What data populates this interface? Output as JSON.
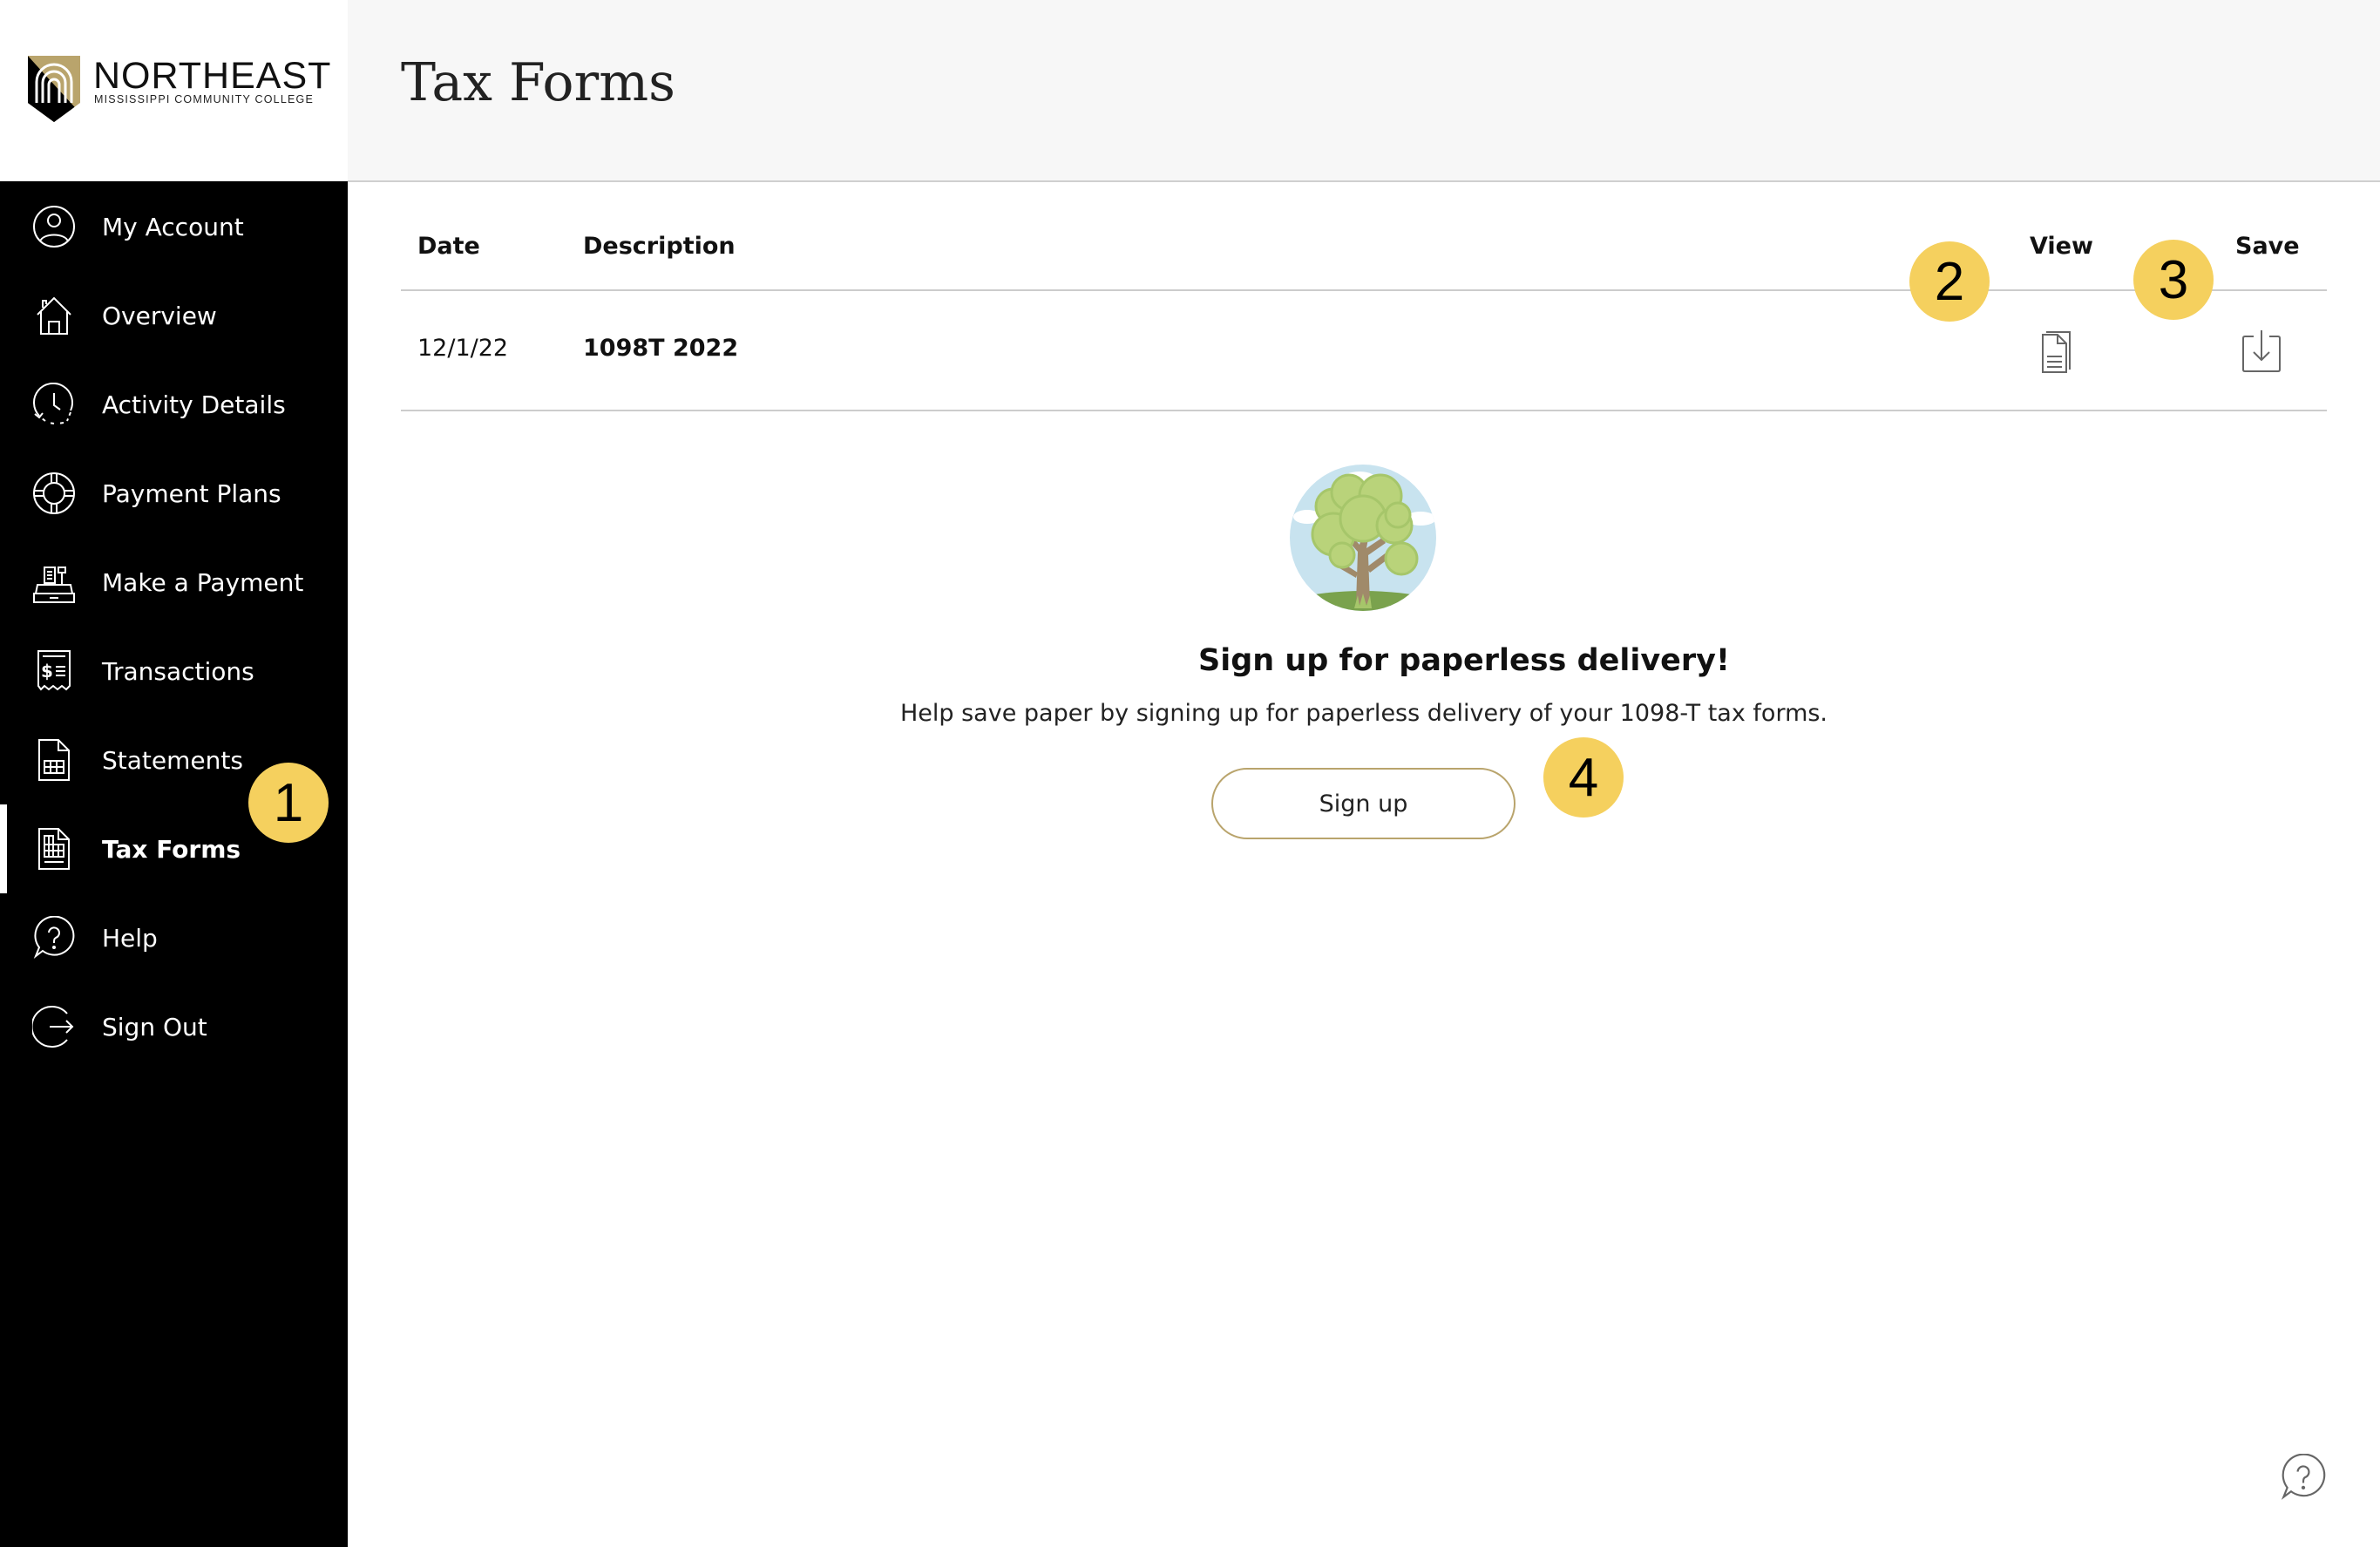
{
  "brand": {
    "name": "NORTHEAST",
    "subtitle": "MISSISSIPPI COMMUNITY COLLEGE",
    "colors": {
      "gold": "#b9a46c",
      "black": "#000000"
    }
  },
  "header": {
    "title": "Tax Forms"
  },
  "sidebar": {
    "active": "Tax Forms",
    "items": [
      {
        "label": "My Account",
        "icon": "user-circle-icon"
      },
      {
        "label": "Overview",
        "icon": "home-icon"
      },
      {
        "label": "Activity Details",
        "icon": "clock-history-icon"
      },
      {
        "label": "Payment Plans",
        "icon": "lifebuoy-icon"
      },
      {
        "label": "Make a Payment",
        "icon": "cash-register-icon"
      },
      {
        "label": "Transactions",
        "icon": "receipt-dollar-icon"
      },
      {
        "label": "Statements",
        "icon": "spreadsheet-document-icon"
      },
      {
        "label": "Tax Forms",
        "icon": "tax-form-document-icon"
      },
      {
        "label": "Help",
        "icon": "help-chat-icon"
      },
      {
        "label": "Sign Out",
        "icon": "sign-out-icon"
      }
    ]
  },
  "table": {
    "columns": [
      "Date",
      "Description",
      "View",
      "Save"
    ],
    "rows": [
      {
        "date": "12/1/22",
        "description": "1098T 2022",
        "view_icon": "document-icon",
        "save_icon": "download-icon"
      }
    ]
  },
  "paperless": {
    "heading": "Sign up for paperless delivery!",
    "text": "Help save paper by signing up for paperless delivery of your 1098-T tax forms.",
    "button_label": "Sign up",
    "illustration": "tree-illustration"
  },
  "annotations": {
    "badge_color": "#f5d05e",
    "badges": [
      "1",
      "2",
      "3",
      "4"
    ]
  },
  "help_fab": {
    "icon": "help-chat-icon"
  }
}
